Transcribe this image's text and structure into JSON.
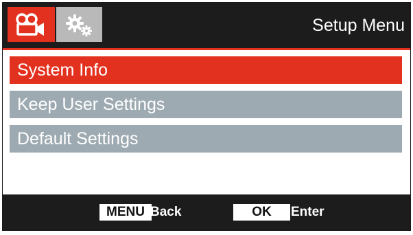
{
  "header": {
    "title": "Setup Menu",
    "tabs": [
      {
        "icon": "video-camera-icon",
        "active": true
      },
      {
        "icon": "gears-icon",
        "active": false
      }
    ]
  },
  "menu": {
    "items": [
      {
        "label": "System Info",
        "selected": true
      },
      {
        "label": "Keep User Settings",
        "selected": false
      },
      {
        "label": "Default Settings",
        "selected": false
      }
    ]
  },
  "footer": {
    "menu_key": "MENU",
    "menu_action": "Back",
    "ok_key": "OK",
    "ok_action": "Enter"
  },
  "colors": {
    "accent": "#e3311f",
    "bar": "#1c1c1c",
    "item_inactive": "#9eaab1",
    "tab_inactive": "#b9b9b9"
  }
}
